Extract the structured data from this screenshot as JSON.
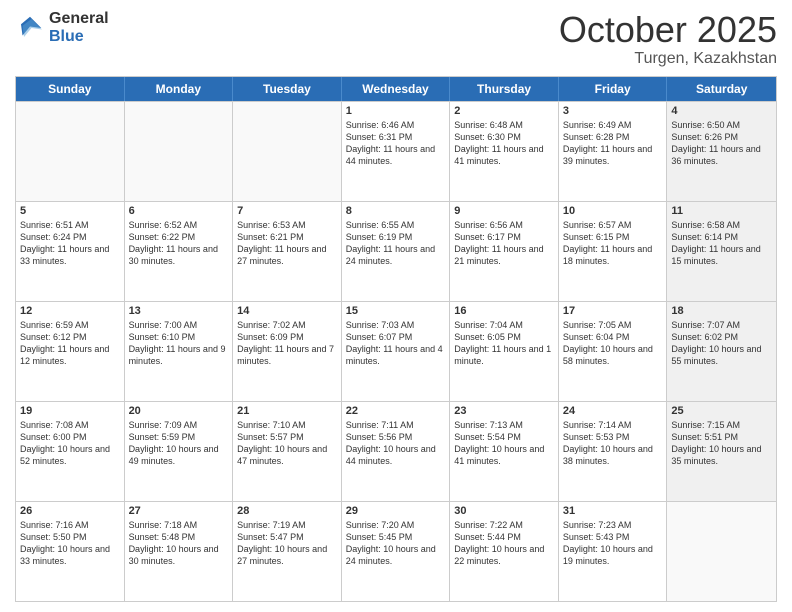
{
  "header": {
    "logo_general": "General",
    "logo_blue": "Blue",
    "title": "October 2025",
    "location": "Turgen, Kazakhstan"
  },
  "days": [
    "Sunday",
    "Monday",
    "Tuesday",
    "Wednesday",
    "Thursday",
    "Friday",
    "Saturday"
  ],
  "rows": [
    [
      {
        "day": "",
        "content": "",
        "empty": true
      },
      {
        "day": "",
        "content": "",
        "empty": true
      },
      {
        "day": "",
        "content": "",
        "empty": true
      },
      {
        "day": "1",
        "content": "Sunrise: 6:46 AM\nSunset: 6:31 PM\nDaylight: 11 hours and 44 minutes.",
        "empty": false
      },
      {
        "day": "2",
        "content": "Sunrise: 6:48 AM\nSunset: 6:30 PM\nDaylight: 11 hours and 41 minutes.",
        "empty": false
      },
      {
        "day": "3",
        "content": "Sunrise: 6:49 AM\nSunset: 6:28 PM\nDaylight: 11 hours and 39 minutes.",
        "empty": false
      },
      {
        "day": "4",
        "content": "Sunrise: 6:50 AM\nSunset: 6:26 PM\nDaylight: 11 hours and 36 minutes.",
        "empty": false,
        "shaded": true
      }
    ],
    [
      {
        "day": "5",
        "content": "Sunrise: 6:51 AM\nSunset: 6:24 PM\nDaylight: 11 hours and 33 minutes.",
        "empty": false
      },
      {
        "day": "6",
        "content": "Sunrise: 6:52 AM\nSunset: 6:22 PM\nDaylight: 11 hours and 30 minutes.",
        "empty": false
      },
      {
        "day": "7",
        "content": "Sunrise: 6:53 AM\nSunset: 6:21 PM\nDaylight: 11 hours and 27 minutes.",
        "empty": false
      },
      {
        "day": "8",
        "content": "Sunrise: 6:55 AM\nSunset: 6:19 PM\nDaylight: 11 hours and 24 minutes.",
        "empty": false
      },
      {
        "day": "9",
        "content": "Sunrise: 6:56 AM\nSunset: 6:17 PM\nDaylight: 11 hours and 21 minutes.",
        "empty": false
      },
      {
        "day": "10",
        "content": "Sunrise: 6:57 AM\nSunset: 6:15 PM\nDaylight: 11 hours and 18 minutes.",
        "empty": false
      },
      {
        "day": "11",
        "content": "Sunrise: 6:58 AM\nSunset: 6:14 PM\nDaylight: 11 hours and 15 minutes.",
        "empty": false,
        "shaded": true
      }
    ],
    [
      {
        "day": "12",
        "content": "Sunrise: 6:59 AM\nSunset: 6:12 PM\nDaylight: 11 hours and 12 minutes.",
        "empty": false
      },
      {
        "day": "13",
        "content": "Sunrise: 7:00 AM\nSunset: 6:10 PM\nDaylight: 11 hours and 9 minutes.",
        "empty": false
      },
      {
        "day": "14",
        "content": "Sunrise: 7:02 AM\nSunset: 6:09 PM\nDaylight: 11 hours and 7 minutes.",
        "empty": false
      },
      {
        "day": "15",
        "content": "Sunrise: 7:03 AM\nSunset: 6:07 PM\nDaylight: 11 hours and 4 minutes.",
        "empty": false
      },
      {
        "day": "16",
        "content": "Sunrise: 7:04 AM\nSunset: 6:05 PM\nDaylight: 11 hours and 1 minute.",
        "empty": false
      },
      {
        "day": "17",
        "content": "Sunrise: 7:05 AM\nSunset: 6:04 PM\nDaylight: 10 hours and 58 minutes.",
        "empty": false
      },
      {
        "day": "18",
        "content": "Sunrise: 7:07 AM\nSunset: 6:02 PM\nDaylight: 10 hours and 55 minutes.",
        "empty": false,
        "shaded": true
      }
    ],
    [
      {
        "day": "19",
        "content": "Sunrise: 7:08 AM\nSunset: 6:00 PM\nDaylight: 10 hours and 52 minutes.",
        "empty": false
      },
      {
        "day": "20",
        "content": "Sunrise: 7:09 AM\nSunset: 5:59 PM\nDaylight: 10 hours and 49 minutes.",
        "empty": false
      },
      {
        "day": "21",
        "content": "Sunrise: 7:10 AM\nSunset: 5:57 PM\nDaylight: 10 hours and 47 minutes.",
        "empty": false
      },
      {
        "day": "22",
        "content": "Sunrise: 7:11 AM\nSunset: 5:56 PM\nDaylight: 10 hours and 44 minutes.",
        "empty": false
      },
      {
        "day": "23",
        "content": "Sunrise: 7:13 AM\nSunset: 5:54 PM\nDaylight: 10 hours and 41 minutes.",
        "empty": false
      },
      {
        "day": "24",
        "content": "Sunrise: 7:14 AM\nSunset: 5:53 PM\nDaylight: 10 hours and 38 minutes.",
        "empty": false
      },
      {
        "day": "25",
        "content": "Sunrise: 7:15 AM\nSunset: 5:51 PM\nDaylight: 10 hours and 35 minutes.",
        "empty": false,
        "shaded": true
      }
    ],
    [
      {
        "day": "26",
        "content": "Sunrise: 7:16 AM\nSunset: 5:50 PM\nDaylight: 10 hours and 33 minutes.",
        "empty": false
      },
      {
        "day": "27",
        "content": "Sunrise: 7:18 AM\nSunset: 5:48 PM\nDaylight: 10 hours and 30 minutes.",
        "empty": false
      },
      {
        "day": "28",
        "content": "Sunrise: 7:19 AM\nSunset: 5:47 PM\nDaylight: 10 hours and 27 minutes.",
        "empty": false
      },
      {
        "day": "29",
        "content": "Sunrise: 7:20 AM\nSunset: 5:45 PM\nDaylight: 10 hours and 24 minutes.",
        "empty": false
      },
      {
        "day": "30",
        "content": "Sunrise: 7:22 AM\nSunset: 5:44 PM\nDaylight: 10 hours and 22 minutes.",
        "empty": false
      },
      {
        "day": "31",
        "content": "Sunrise: 7:23 AM\nSunset: 5:43 PM\nDaylight: 10 hours and 19 minutes.",
        "empty": false
      },
      {
        "day": "",
        "content": "",
        "empty": true,
        "shaded": true
      }
    ]
  ]
}
